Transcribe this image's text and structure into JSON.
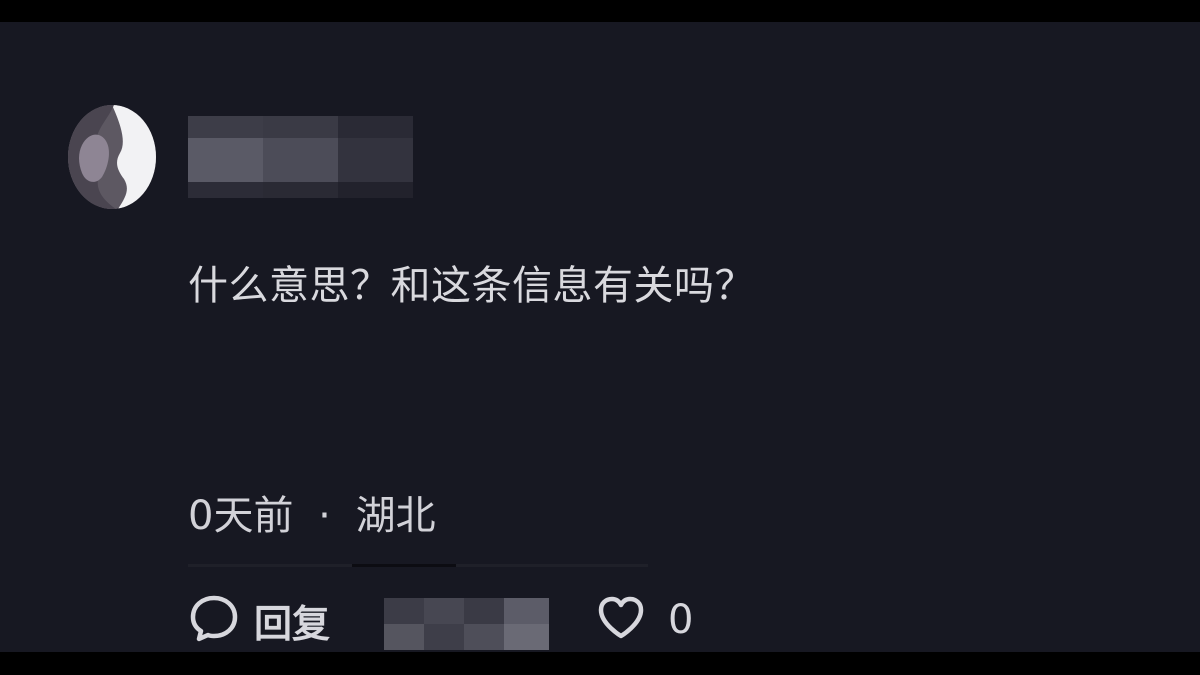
{
  "comment": {
    "author": {
      "name_obscured": true
    },
    "text": "什么意思？和这条信息有关吗？",
    "time": "0天前",
    "separator": "·",
    "location": "湖北"
  },
  "actions": {
    "reply_label": "回复",
    "like_count": "0"
  },
  "icons": {
    "reply": "speech-bubble-icon",
    "like": "heart-icon"
  },
  "colors": {
    "background": "#171822",
    "text": "#d9d9de"
  }
}
